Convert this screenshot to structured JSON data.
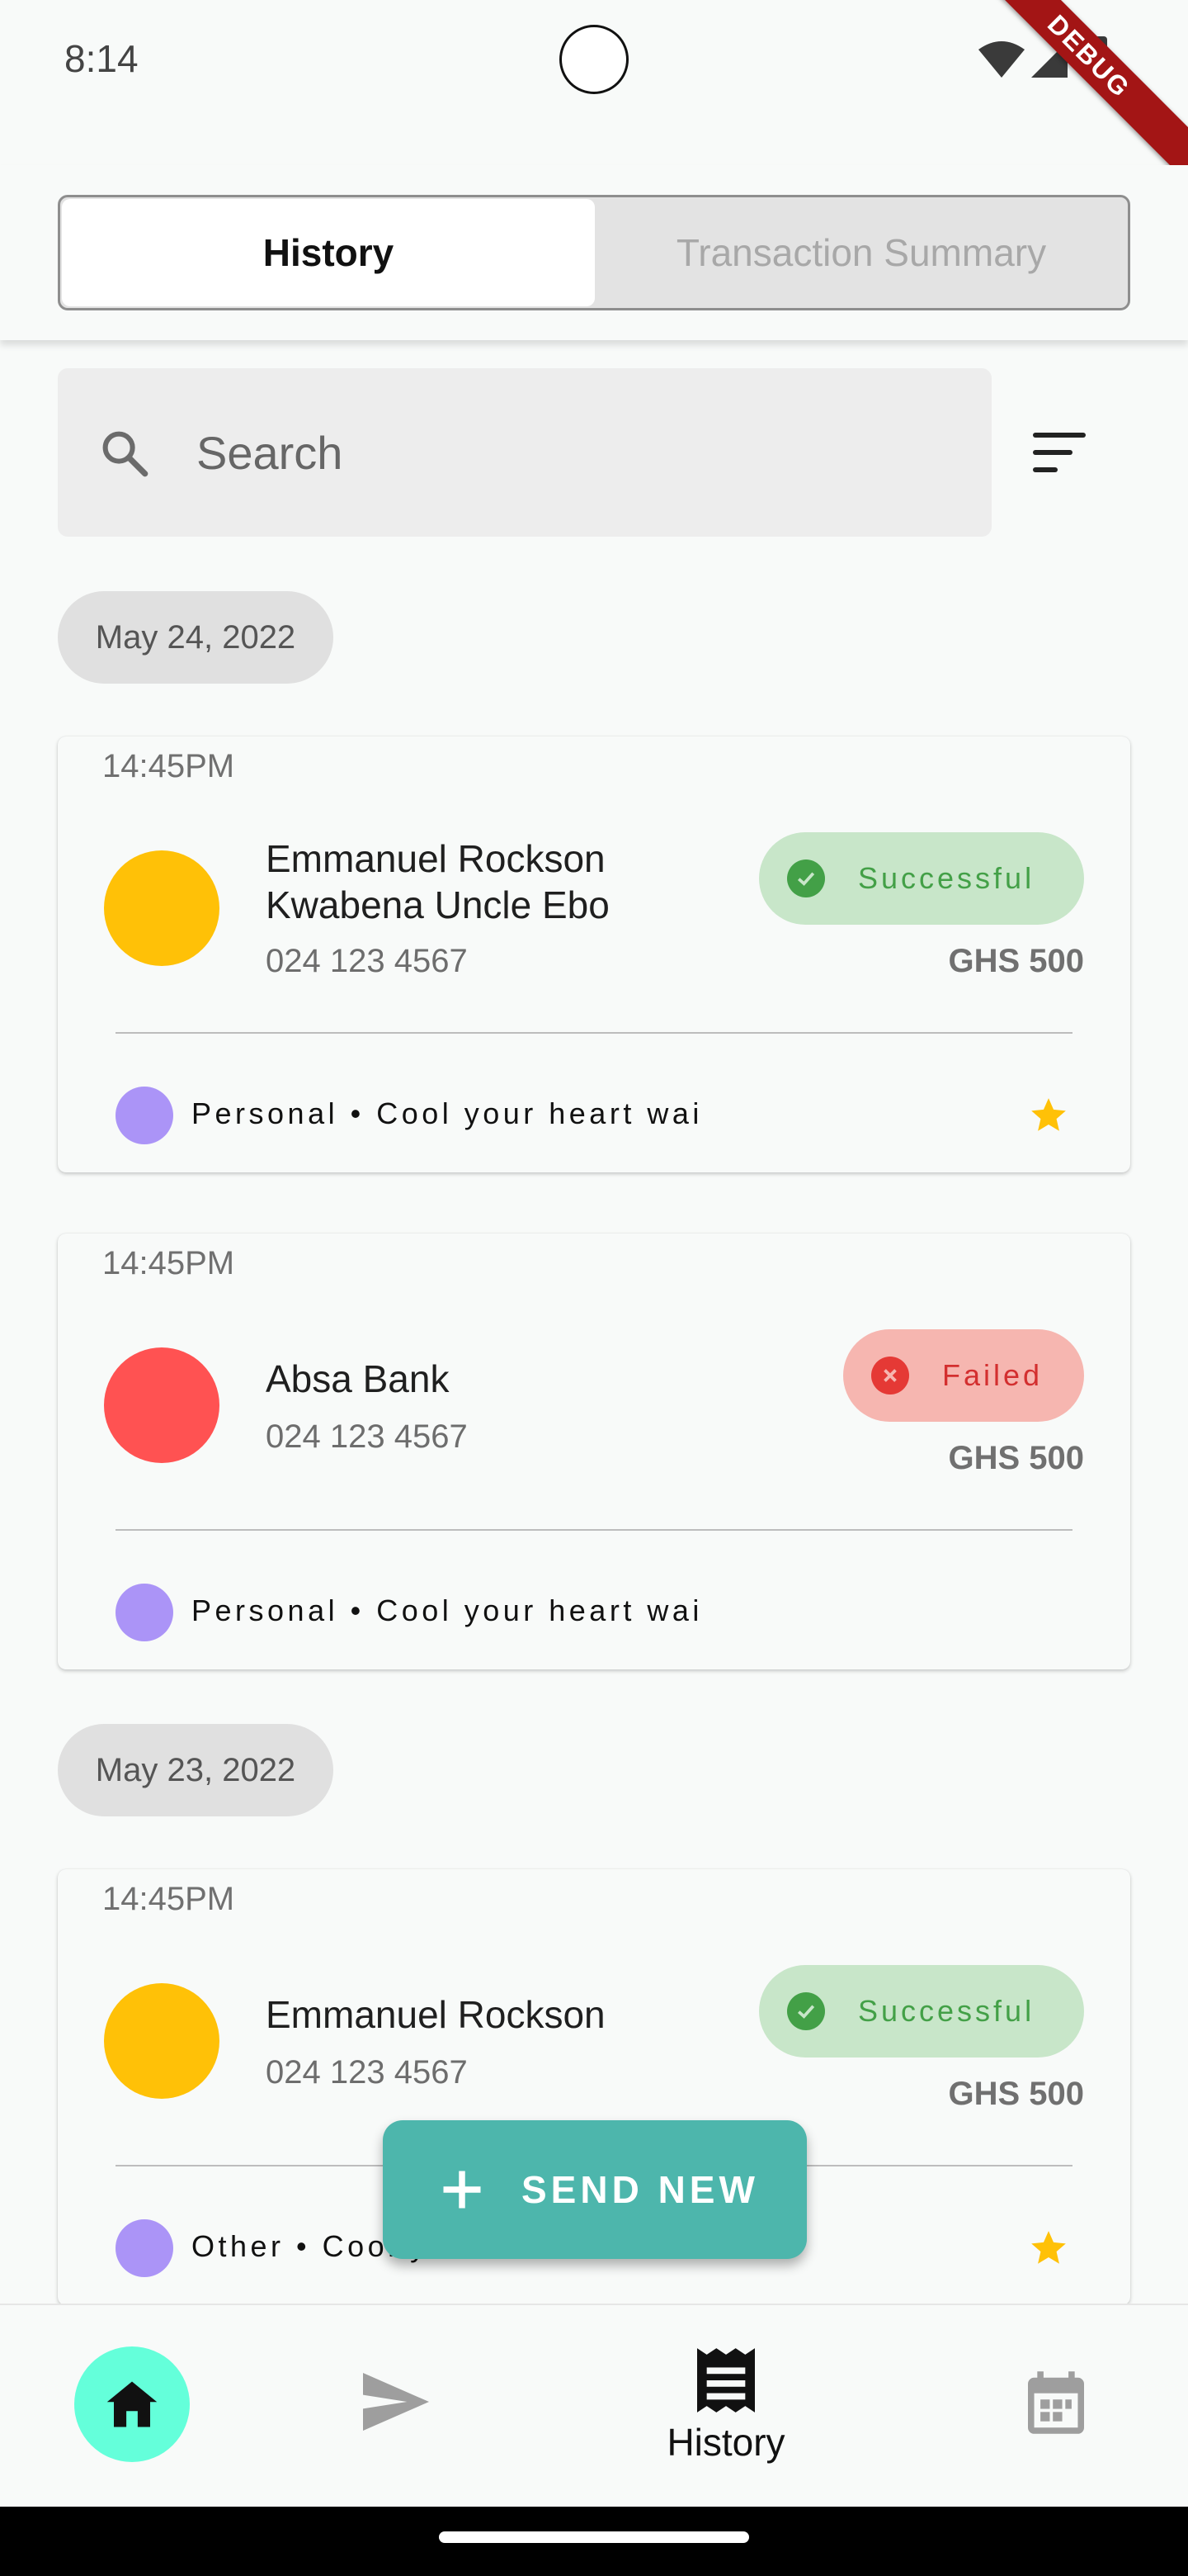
{
  "status_bar": {
    "time": "8:14",
    "debug": "DEBUG"
  },
  "tabs": {
    "active": "History",
    "inactive": "Transaction Summary"
  },
  "search": {
    "placeholder": "Search"
  },
  "groups": [
    {
      "date": "May 24, 2022",
      "cards": [
        {
          "time": "14:45PM",
          "name": "Emmanuel Rockson Kwabena Uncle Ebo",
          "phone": "024 123 4567",
          "status": "Successful",
          "amount": "GHS 500",
          "tag": "Personal • Cool your heart wai",
          "avatar_color": "#ffc107",
          "starred": true
        },
        {
          "time": "14:45PM",
          "name": "Absa Bank",
          "phone": "024 123 4567",
          "status": "Failed",
          "amount": "GHS 500",
          "tag": "Personal • Cool your heart wai",
          "avatar_color": "#ff5252",
          "starred": false
        }
      ]
    },
    {
      "date": "May 23, 2022",
      "cards": [
        {
          "time": "14:45PM",
          "name": "Emmanuel Rockson",
          "phone": "024 123 4567",
          "status": "Successful",
          "amount": "GHS 500",
          "tag": "Other • Cool y",
          "avatar_color": "#ffc107",
          "starred": true
        }
      ]
    }
  ],
  "fab": {
    "label": "SEND NEW"
  },
  "bottom_nav": {
    "active_label": "History"
  },
  "colors": {
    "accent": "#4db6ac",
    "home_bg": "#64ffda",
    "success": "#43a047",
    "failed": "#e53935",
    "star": "#ffc107",
    "tag_dot": "#ab94f7"
  },
  "icons": [
    "search-icon",
    "filter-icon",
    "check-circle-icon",
    "cancel-circle-icon",
    "star-icon",
    "plus-icon",
    "home-icon",
    "send-icon",
    "receipt-icon",
    "calendar-icon"
  ]
}
